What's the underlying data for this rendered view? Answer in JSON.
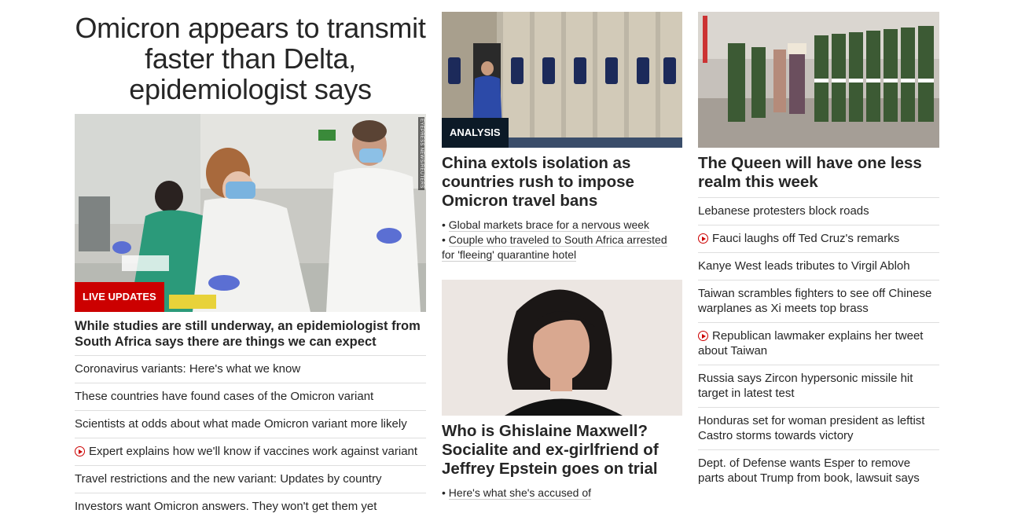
{
  "col1": {
    "headline": "Omicron appears to transmit faster than Delta, epidemiologist says",
    "badge": "LIVE UPDATES",
    "image_credit": "EYEPRESS NEWS/REUTERS",
    "caption": "While studies are still underway, an epidemiologist from South Africa says there are things we can expect",
    "links": [
      {
        "text": "Coronavirus variants: Here's what we know",
        "video": false
      },
      {
        "text": "These countries have found cases of the Omicron variant",
        "video": false
      },
      {
        "text": "Scientists at odds about what made Omicron variant more likely",
        "video": false
      },
      {
        "text": "Expert explains how we'll know if vaccines work against variant",
        "video": true
      },
      {
        "text": "Travel restrictions and the new variant: Updates by country",
        "video": false
      },
      {
        "text": "Investors want Omicron answers. They won't get them yet",
        "video": false
      }
    ]
  },
  "col2": {
    "story1": {
      "badge": "ANALYSIS",
      "headline": "China extols isolation as countries rush to impose Omicron travel bans",
      "sublinks": [
        "Global markets brace for a nervous week",
        "Couple who traveled to South Africa arrested for 'fleeing' quarantine hotel"
      ]
    },
    "story2": {
      "headline": "Who is Ghislaine Maxwell? Socialite and ex-girlfriend of Jeffrey Epstein goes on trial",
      "sublinks": [
        "Here's what she's accused of"
      ]
    }
  },
  "col3": {
    "headline": "The Queen will have one less realm this week",
    "links": [
      {
        "text": "Lebanese protesters block roads",
        "video": false
      },
      {
        "text": "Fauci laughs off Ted Cruz's remarks",
        "video": true
      },
      {
        "text": "Kanye West leads tributes to Virgil Abloh",
        "video": false
      },
      {
        "text": "Taiwan scrambles fighters to see off Chinese warplanes as Xi meets top brass",
        "video": false
      },
      {
        "text": "Republican lawmaker explains her tweet about Taiwan",
        "video": true
      },
      {
        "text": "Russia says Zircon hypersonic missile hit target in latest test",
        "video": false
      },
      {
        "text": "Honduras set for woman president as leftist Castro storms towards victory",
        "video": false
      },
      {
        "text": "Dept. of Defense wants Esper to remove parts about Trump from book, lawsuit says",
        "video": false
      }
    ]
  },
  "colors": {
    "accent_red": "#cc0000",
    "analysis_badge": "#0c1a27",
    "text": "#262626",
    "divider": "#dedede"
  }
}
